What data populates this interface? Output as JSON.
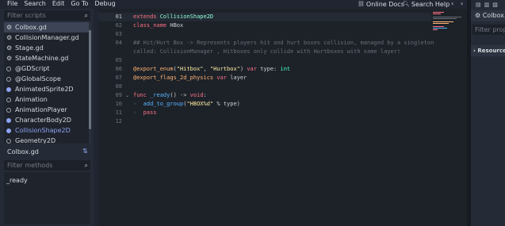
{
  "menu": {
    "items": [
      "File",
      "Search",
      "Edit",
      "Go To",
      "Debug"
    ],
    "online_docs": "Online Docs",
    "search_help": "Search Help",
    "prev_arrow": "‹",
    "next_arrow": "›",
    "options_glyph": "⋮"
  },
  "scripts_panel": {
    "filter_placeholder": "Filter scripts",
    "items": [
      {
        "label": "Colbox.gd",
        "icon": "gear-icon",
        "selected": true
      },
      {
        "label": "CollisionManager.gd",
        "icon": "gear-icon"
      },
      {
        "label": "Stage.gd",
        "icon": "gear-icon"
      },
      {
        "label": "StateMachine.gd",
        "icon": "gear-icon"
      },
      {
        "label": "@GDScript",
        "icon": "node-icon"
      },
      {
        "label": "@GlobalScope",
        "icon": "node-icon"
      },
      {
        "label": "AnimatedSprite2D",
        "icon": "node-icon"
      },
      {
        "label": "Animation",
        "icon": "node-icon"
      },
      {
        "label": "AnimationPlayer",
        "icon": "node-icon"
      },
      {
        "label": "CharacterBody2D",
        "icon": "node-icon"
      },
      {
        "label": "CollisionShape2D",
        "icon": "node-icon",
        "highlight": true
      },
      {
        "label": "Geometry2D",
        "icon": "node-icon"
      }
    ],
    "current_script": "Colbox.gd",
    "methods_filter_placeholder": "Filter methods",
    "methods": [
      "_ready"
    ]
  },
  "editor": {
    "lines": [
      {
        "num": "01",
        "current": true,
        "tokens": [
          [
            "kw",
            "extends "
          ],
          [
            "cls",
            "CollisionShape2D"
          ]
        ]
      },
      {
        "num": "02",
        "tokens": [
          [
            "kw",
            "class_name "
          ],
          [
            "",
            "HBox"
          ]
        ]
      },
      {
        "num": "03",
        "tokens": []
      },
      {
        "num": "04",
        "tokens": [
          [
            "cm",
            "## Hit/Hurt Box -> Represents players hit and hurt boxes collision, managed by a singleton"
          ]
        ]
      },
      {
        "num": "",
        "tokens": [
          [
            "cm",
            "called: CollisionManager , Hitboxes only collide with Hurtboxes with same layer!"
          ]
        ]
      },
      {
        "num": "05",
        "tokens": []
      },
      {
        "num": "06",
        "tokens": [
          [
            "an",
            "@export_enum"
          ],
          [
            "",
            "("
          ],
          [
            "str",
            "\"Hitbox\""
          ],
          [
            "",
            ", "
          ],
          [
            "str",
            "\"Hurtbox\""
          ],
          [
            "",
            ") "
          ],
          [
            "kw",
            "var "
          ],
          [
            "",
            "type: "
          ],
          [
            "ty",
            "int"
          ]
        ]
      },
      {
        "num": "07",
        "tokens": [
          [
            "an",
            "@export_flags_2d_physics "
          ],
          [
            "kw",
            "var "
          ],
          [
            "",
            "layer"
          ]
        ]
      },
      {
        "num": "08",
        "tokens": []
      },
      {
        "num": "09",
        "fold": true,
        "tokens": [
          [
            "kw",
            "func "
          ],
          [
            "fn",
            "_ready"
          ],
          [
            "",
            "() -> "
          ],
          [
            "kw",
            "void"
          ],
          [
            "",
            ":"
          ]
        ]
      },
      {
        "num": "10",
        "tokens": [
          [
            "tab-guide",
            "»  "
          ],
          [
            "fn",
            "add_to_group"
          ],
          [
            "",
            "("
          ],
          [
            "str",
            "\"HBOX%d\""
          ],
          [
            "",
            " % type)"
          ]
        ]
      },
      {
        "num": "11",
        "tokens": [
          [
            "tab-guide",
            "»  "
          ],
          [
            "kw",
            "pass"
          ]
        ]
      },
      {
        "num": "12",
        "tokens": []
      }
    ]
  },
  "right_dock": {
    "tab_label": "Colbox...",
    "filter_placeholder": "Filter prope",
    "section_label": "Resource"
  },
  "colors": {
    "background": "#202531",
    "editor_bg": "#1d2229",
    "keyword": "#ff7085",
    "string": "#ffeda1",
    "comment": "#676d77",
    "annotation": "#ffb373",
    "function": "#57b3ff",
    "type": "#42ffc2",
    "accent": "#8da5f3"
  }
}
